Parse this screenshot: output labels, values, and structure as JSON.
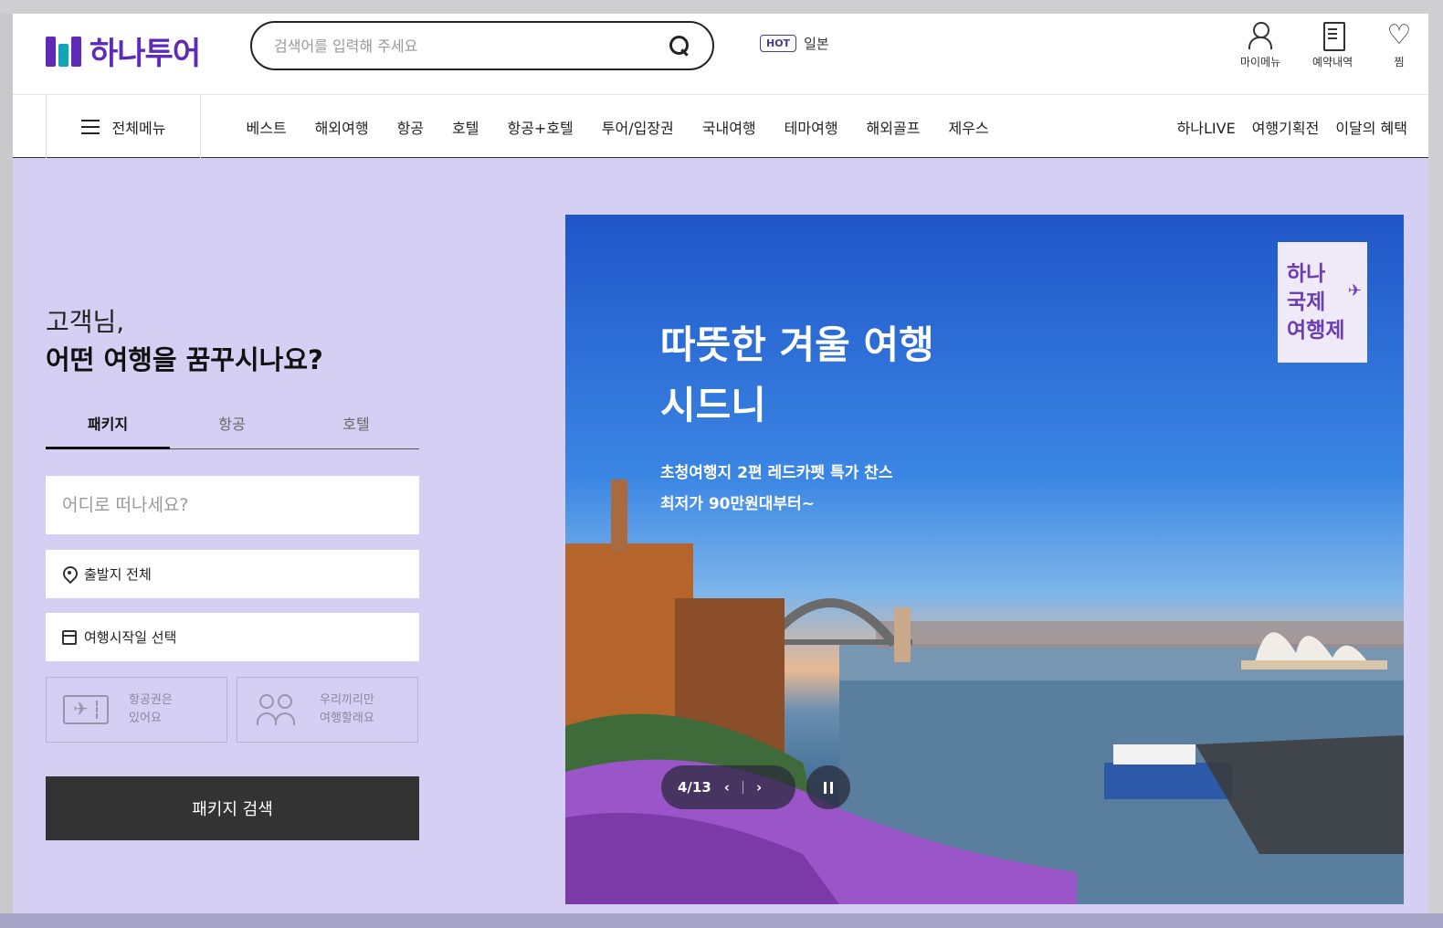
{
  "header": {
    "logo_text": "하나투어",
    "search_placeholder": "검색어를 입력해 주세요",
    "hot_badge": "HOT",
    "hot_keyword": "일본",
    "utility": [
      {
        "label": "마이메뉴",
        "icon": "user-menu-icon"
      },
      {
        "label": "예약내역",
        "icon": "document-icon"
      },
      {
        "label": "찜",
        "icon": "heart-icon"
      }
    ]
  },
  "nav": {
    "all_menu": "전체메뉴",
    "items": [
      "베스트",
      "해외여행",
      "항공",
      "호텔",
      "항공+호텔",
      "투어/입장권",
      "국내여행",
      "테마여행",
      "해외골프",
      "제우스"
    ],
    "right_items": [
      "하나LIVE",
      "여행기획전",
      "이달의 혜택"
    ]
  },
  "search_panel": {
    "greeting_line1": "고객님,",
    "greeting_line2": "어떤 여행을 꿈꾸시나요?",
    "tabs": [
      {
        "label": "패키지",
        "active": true
      },
      {
        "label": "항공",
        "active": false
      },
      {
        "label": "호텔",
        "active": false
      }
    ],
    "destination_placeholder": "어디로 떠나세요?",
    "departure": "출발지 전체",
    "start_date": "여행시작일 선택",
    "option_flight_line1": "항공권은",
    "option_flight_line2": "있어요",
    "option_group_line1": "우리끼리만",
    "option_group_line2": "여행할래요",
    "search_button": "패키지 검색"
  },
  "banner": {
    "title_line1": "따뜻한 겨울 여행",
    "title_line2": "시드니",
    "sub_line1": "초청여행지 2편 레드카펫 특가 찬스",
    "sub_line2": "최저가 90만원대부터~",
    "stamp_line1": "하나",
    "stamp_line2": "국제",
    "stamp_line3": "여행제",
    "page_indicator": "4/13"
  },
  "colors": {
    "brand": "#5e2bb8",
    "brand_secondary": "#10a6b8",
    "page_bg": "#d4cff3",
    "button_dark": "#333333"
  }
}
